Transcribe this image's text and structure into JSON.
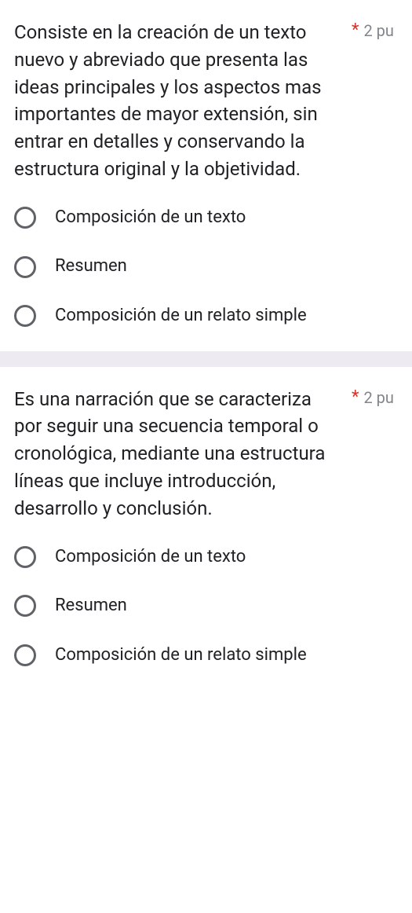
{
  "questions": [
    {
      "text": "Consiste en la creación de un texto nuevo y abreviado que presenta las ideas principales y los aspectos mas importantes de mayor extensión, sin entrar en detalles y conservando la estructura original y la objetividad.",
      "required": "*",
      "points": "2 pu",
      "options": [
        "Composición de un texto",
        "Resumen",
        "Composición de un relato simple"
      ]
    },
    {
      "text": "Es una narración que se caracteriza por seguir una secuencia temporal o cronológica, mediante una estructura líneas que incluye introducción, desarrollo y conclusión.",
      "required": "*",
      "points": "2 pu",
      "options": [
        "Composición de un texto",
        "Resumen",
        "Composición de un relato simple"
      ]
    }
  ]
}
